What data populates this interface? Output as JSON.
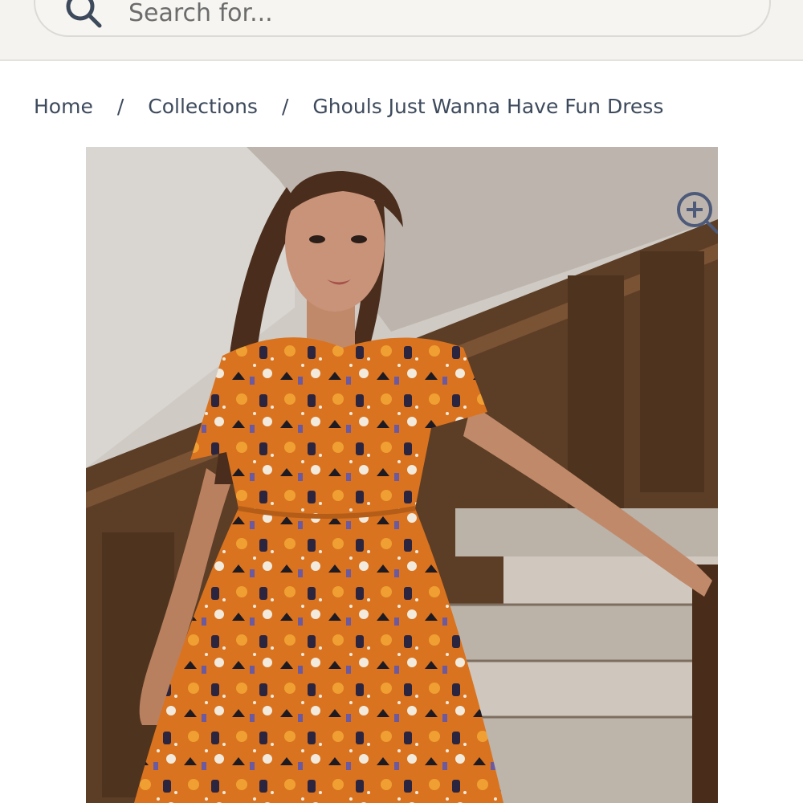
{
  "search": {
    "placeholder": "Search for..."
  },
  "breadcrumb": {
    "home": "Home",
    "collections": "Collections",
    "separator": "/",
    "current": "Ghouls Just Wanna Have Fun Dress"
  },
  "product": {
    "image_alt": "Ghouls Just Wanna Have Fun Dress",
    "zoom_icon": "zoom-in-icon"
  },
  "colors": {
    "header_bg": "#f4f3ef",
    "text": "#3d4a5c",
    "dress_orange": "#d9731f"
  }
}
